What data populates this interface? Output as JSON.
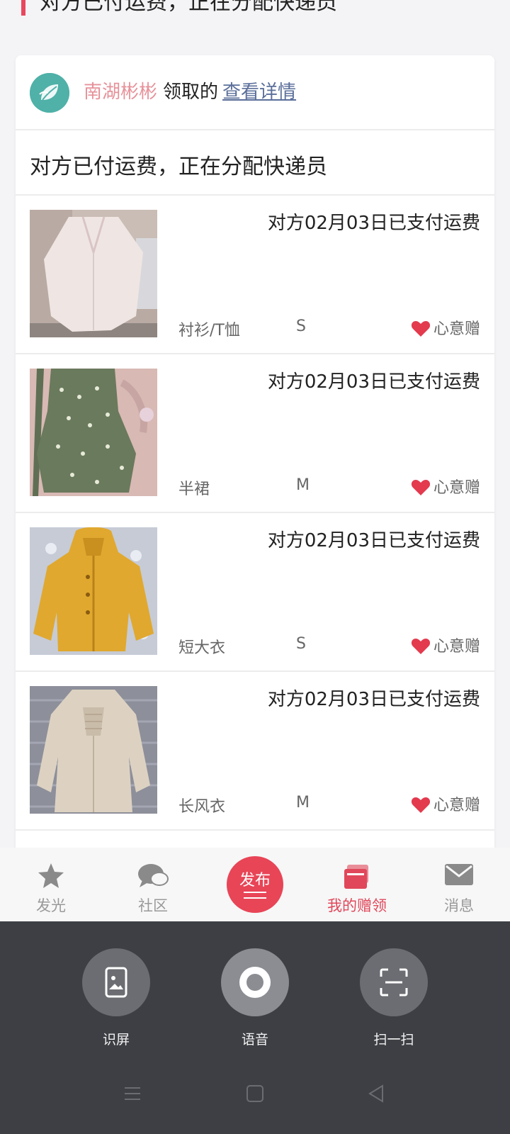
{
  "header": {
    "title": "对方已付运费，正在分配快递员"
  },
  "card": {
    "user": "南湖彬彬",
    "verb": "领取的",
    "link": "查看详情",
    "status": "对方已付运费，正在分配快递员",
    "items": [
      {
        "paid": "对方02月03日已支付运费",
        "category": "衬衫/T恤",
        "size": "S",
        "tag": "心意赠"
      },
      {
        "paid": "对方02月03日已支付运费",
        "category": "半裙",
        "size": "M",
        "tag": "心意赠"
      },
      {
        "paid": "对方02月03日已支付运费",
        "category": "短大衣",
        "size": "S",
        "tag": "心意赠"
      },
      {
        "paid": "对方02月03日已支付运费",
        "category": "长风衣",
        "size": "M",
        "tag": "心意赠"
      }
    ]
  },
  "tabbar": {
    "items": [
      {
        "label": "发光",
        "icon": "star-icon"
      },
      {
        "label": "社区",
        "icon": "chat-bubble-icon"
      },
      {
        "label": "发布",
        "icon": "publish-icon"
      },
      {
        "label": "我的赠领",
        "icon": "gift-box-icon"
      },
      {
        "label": "消息",
        "icon": "envelope-icon"
      }
    ],
    "active": "我的赠领",
    "accent": "#e84557"
  },
  "assistant": {
    "buttons": [
      {
        "label": "识屏",
        "icon": "screen-image-icon"
      },
      {
        "label": "语音",
        "icon": "voice-icon"
      },
      {
        "label": "扫一扫",
        "icon": "scan-icon"
      }
    ]
  },
  "colors": {
    "accent": "#e84557",
    "user_name": "#e6929a",
    "link": "#5b6f9a",
    "assist_bg": "#3d3f44"
  }
}
